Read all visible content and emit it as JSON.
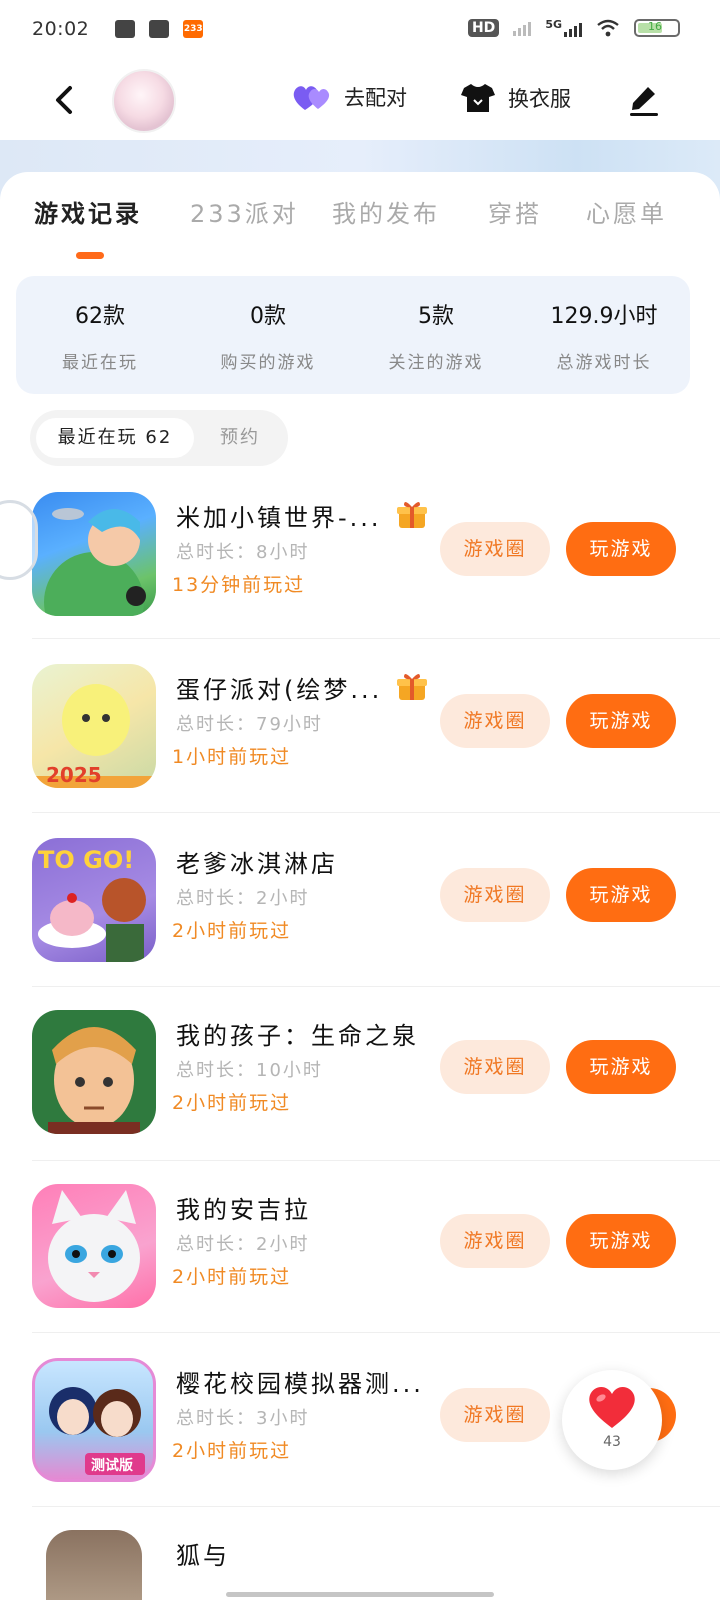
{
  "status_bar": {
    "time": "20:02",
    "network": "5G",
    "battery": "16"
  },
  "header": {
    "match_label": "去配对",
    "dress_label": "换衣服"
  },
  "tabs": [
    {
      "label": "游戏记录"
    },
    {
      "label": "233派对"
    },
    {
      "label": "我的发布"
    },
    {
      "label": "穿搭"
    },
    {
      "label": "心愿单"
    }
  ],
  "stats": [
    {
      "value": "62款",
      "label": "最近在玩"
    },
    {
      "value": "0款",
      "label": "购买的游戏"
    },
    {
      "value": "5款",
      "label": "关注的游戏"
    },
    {
      "value": "129.9小时",
      "label": "总游戏时长"
    }
  ],
  "filter": {
    "selected": "最近在玩 62",
    "other": "预约"
  },
  "games": [
    {
      "title": "米加小镇世界-...",
      "duration": "总时长：8小时",
      "last_played": "13分钟前玩过",
      "has_gift": true
    },
    {
      "title": "蛋仔派对(绘梦...",
      "duration": "总时长：79小时",
      "last_played": "1小时前玩过",
      "has_gift": true
    },
    {
      "title": "老爹冰淇淋店",
      "duration": "总时长：2小时",
      "last_played": "2小时前玩过",
      "has_gift": false
    },
    {
      "title": "我的孩子：生命之泉",
      "duration": "总时长：10小时",
      "last_played": "2小时前玩过",
      "has_gift": false
    },
    {
      "title": "我的安吉拉",
      "duration": "总时长：2小时",
      "last_played": "2小时前玩过",
      "has_gift": false
    },
    {
      "title": "樱花校园模拟器测...",
      "duration": "总时长：3小时",
      "last_played": "2小时前玩过",
      "has_gift": false
    },
    {
      "title": "狐与",
      "duration": "",
      "last_played": "",
      "has_gift": false
    }
  ],
  "buttons": {
    "circle": "游戏圈",
    "play": "玩游戏"
  },
  "like_widget": {
    "count": "43"
  },
  "colors": {
    "accent": "#ff6d12",
    "accent_light": "#fde9dc",
    "stats_bg": "#eef3fb"
  }
}
